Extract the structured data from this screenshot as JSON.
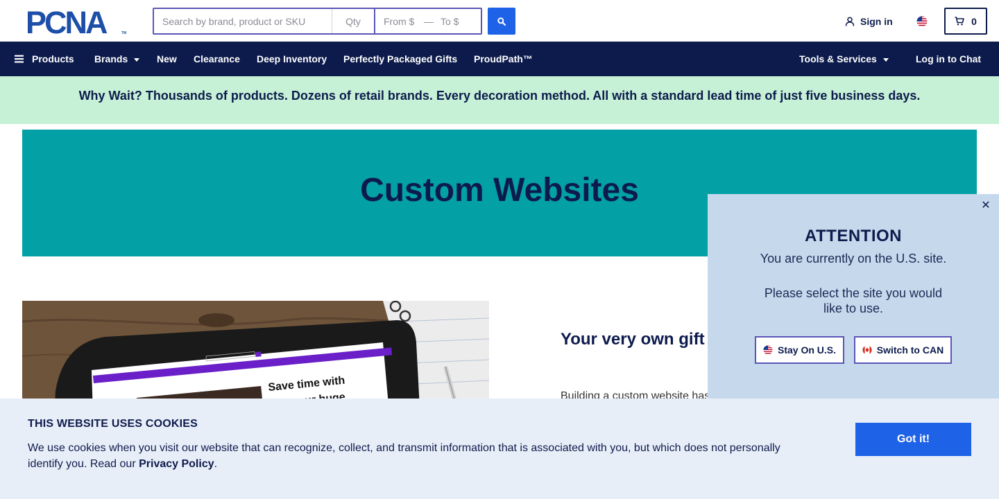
{
  "header": {
    "logo_text": "PCNA",
    "logo_tm": "TM",
    "search_placeholder": "Search by brand, product or SKU",
    "qty_placeholder": "Qty",
    "from_placeholder": "From $",
    "price_separator": "—",
    "to_placeholder": "To $",
    "signin_label": "Sign in",
    "cart_count": "0",
    "search_icon": "search-icon",
    "user_icon": "user-icon",
    "cart_icon": "cart-icon",
    "country_flag": "us-flag-icon"
  },
  "nav": {
    "products": "Products",
    "brands": "Brands",
    "new": "New",
    "clearance": "Clearance",
    "deep_inventory": "Deep Inventory",
    "perfectly_packaged_gifts": "Perfectly Packaged Gifts",
    "proudpath": "ProudPath™",
    "tools_services": "Tools & Services",
    "log_in_chat": "Log in to Chat"
  },
  "promo": {
    "text": "Why Wait? Thousands of products. Dozens of retail brands. Every decoration method. All with a standard lead time of just five business days."
  },
  "hero": {
    "title": "Custom Websites"
  },
  "content": {
    "heading": "Your very own gift shop in a few clicks",
    "body": "Building a custom website has",
    "tablet_text_1": "Save time with",
    "tablet_text_2": "our huge"
  },
  "attention": {
    "close": "✕",
    "title": "ATTENTION",
    "line1": "You are currently on the U.S. site.",
    "line2": "Please select the site you would like to use.",
    "stay_label": "Stay On U.S.",
    "switch_label": "Switch to CAN"
  },
  "cookie": {
    "title": "THIS WEBSITE USES COOKIES",
    "text": "We use cookies when you visit our website that can recognize, collect, and transmit information that is associated with you, but which does not personally identify you. Read our ",
    "link": "Privacy Policy",
    "end": ".",
    "button": "Got it!"
  },
  "colors": {
    "navy": "#0d1b4c",
    "blue": "#1e62e8",
    "teal": "#03a0a6",
    "mint": "#c6f1d6",
    "popup": "#c6d8ec",
    "cookie_bg": "#e8eef8"
  }
}
